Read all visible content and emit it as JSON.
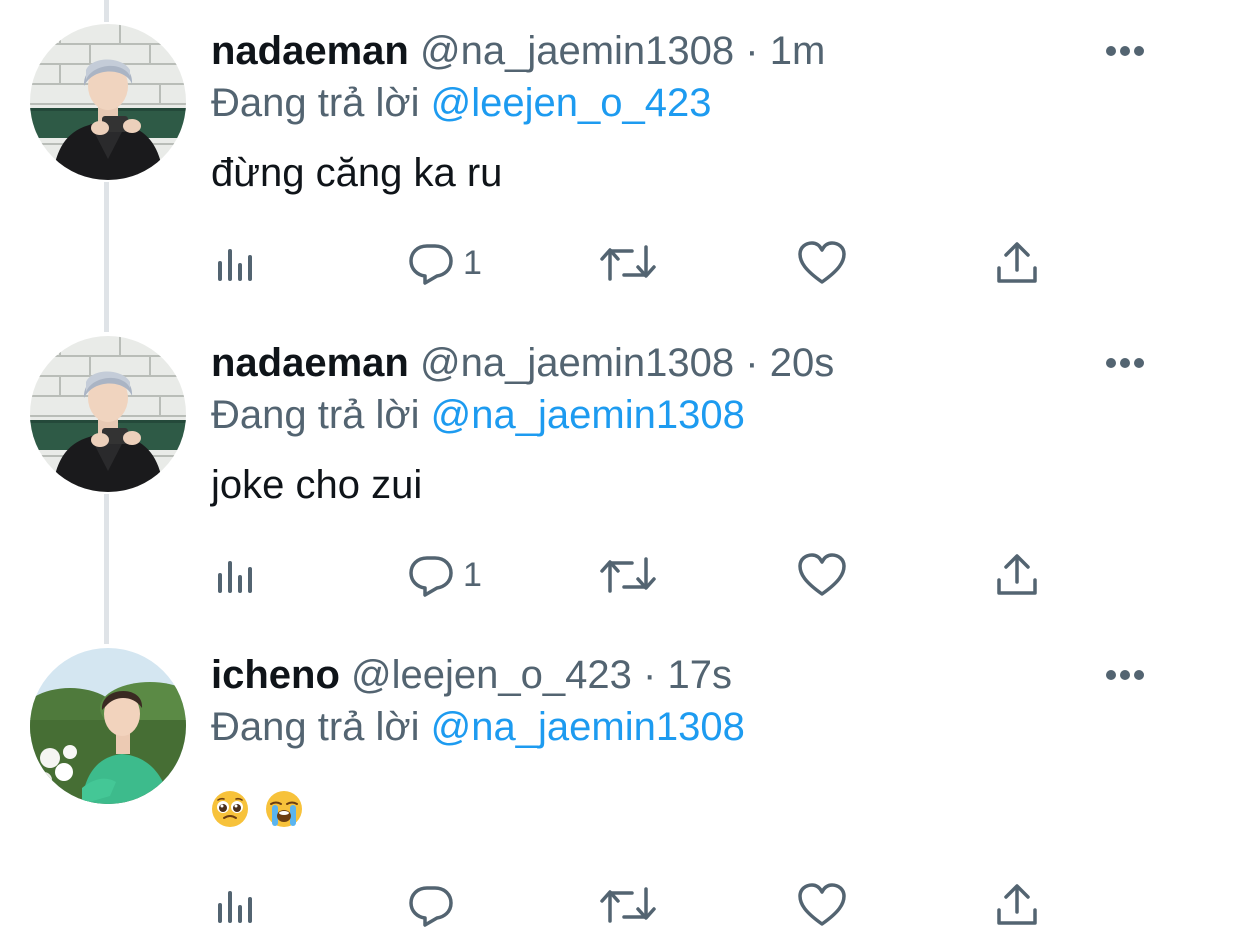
{
  "tweets": [
    {
      "display_name": "nadaeman",
      "handle": "@na_jaemin1308",
      "separator": "·",
      "time": "1m",
      "reply_prefix": "Đang trả lời",
      "reply_to": "@leejen_o_423",
      "text": "đừng căng ka ru",
      "reply_count": "1",
      "avatar": "user-avatar-silver-hair"
    },
    {
      "display_name": "nadaeman",
      "handle": "@na_jaemin1308",
      "separator": "·",
      "time": "20s",
      "reply_prefix": "Đang trả lời",
      "reply_to": "@na_jaemin1308",
      "text": "joke cho zui",
      "reply_count": "1",
      "avatar": "user-avatar-silver-hair"
    },
    {
      "display_name": "icheno",
      "handle": "@leejen_o_423",
      "separator": "·",
      "time": "17s",
      "reply_prefix": "Đang trả lời",
      "reply_to": "@na_jaemin1308",
      "emojis": [
        "pleading-face-emoji",
        "loudly-crying-face-emoji"
      ],
      "reply_count": "",
      "avatar": "user-avatar-green-sweater"
    }
  ],
  "icons": {
    "views": "views-chart-icon",
    "reply": "reply-bubble-icon",
    "retweet": "retweet-icon",
    "like": "heart-icon",
    "share": "share-icon",
    "more": "more-dots-icon"
  },
  "colors": {
    "text": "#0f1419",
    "secondary": "#536471",
    "link": "#1d9bf0",
    "thread_line": "#dfe3e7"
  }
}
